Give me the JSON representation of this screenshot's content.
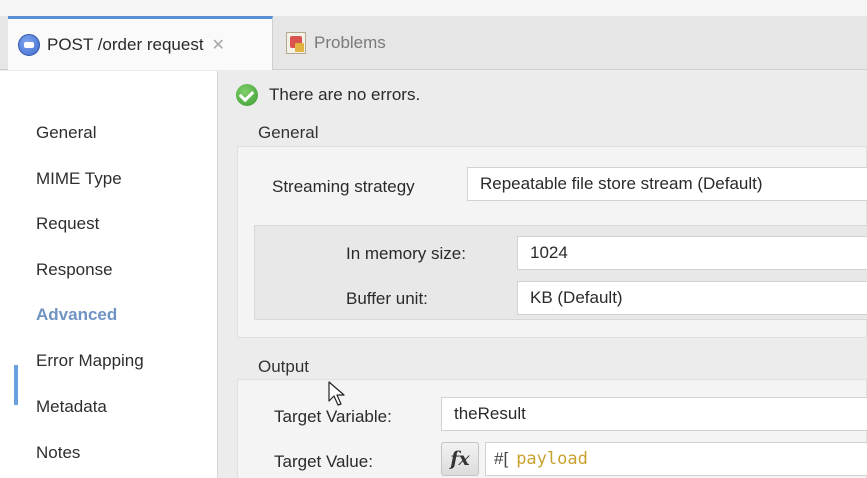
{
  "tabs": {
    "active_label": "POST /order request",
    "inactive_label": "Problems"
  },
  "status": {
    "message": "There are no errors."
  },
  "sidebar": {
    "items": [
      {
        "label": "General"
      },
      {
        "label": "MIME Type"
      },
      {
        "label": "Request"
      },
      {
        "label": "Response"
      },
      {
        "label": "Advanced"
      },
      {
        "label": "Error Mapping"
      },
      {
        "label": "Metadata"
      },
      {
        "label": "Notes"
      }
    ],
    "selected": "Advanced"
  },
  "general": {
    "title": "General",
    "streaming_label": "Streaming strategy",
    "streaming_value": "Repeatable file store stream (Default)",
    "memory_label": "In memory size:",
    "memory_value": "1024",
    "buffer_label": "Buffer unit:",
    "buffer_value": "KB (Default)"
  },
  "output": {
    "title": "Output",
    "target_variable_label": "Target Variable:",
    "target_variable_value": "theResult",
    "target_value_label": "Target Value:",
    "fx_label": "fx",
    "expr_prefix": "#[",
    "expr_body": "payload"
  },
  "colors": {
    "accent": "#6aa0e0",
    "selected_text": "#6f94c4",
    "expression": "#c8a22e"
  }
}
